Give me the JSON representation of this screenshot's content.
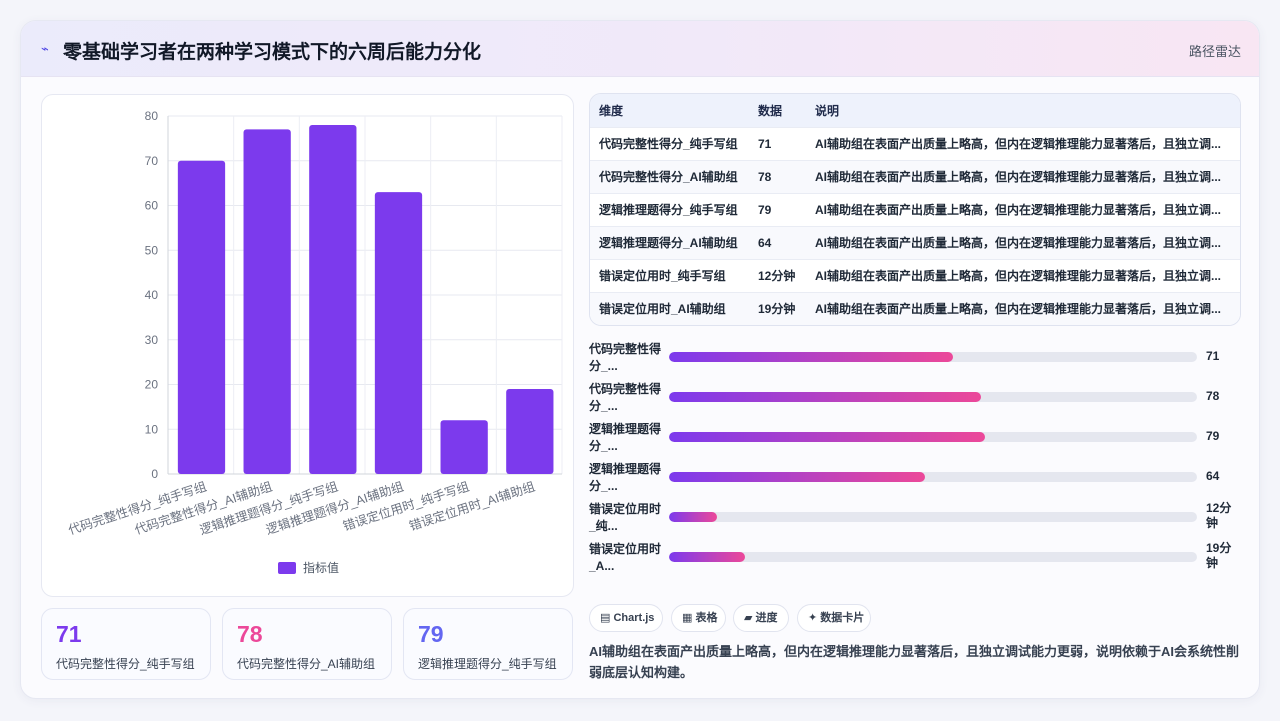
{
  "header": {
    "logo": "⌁",
    "title": "零基础学习者在两种学习模式下的六周后能力分化",
    "tag": "路径雷达"
  },
  "chart_data": {
    "type": "bar",
    "categories": [
      "代码完整性得分_纯手写组",
      "代码完整性得分_AI辅助组",
      "逻辑推理题得分_纯手写组",
      "逻辑推理题得分_AI辅助组",
      "错误定位用时_纯手写组",
      "错误定位用时_AI辅助组"
    ],
    "series": [
      {
        "name": "指标值",
        "values": [
          70,
          77,
          78,
          63,
          12,
          19
        ]
      }
    ],
    "ylim": [
      0,
      80
    ],
    "yticks": [
      0,
      10,
      20,
      30,
      40,
      50,
      60,
      70,
      80
    ],
    "grid": true,
    "legend": "bottom",
    "color": "#7c3aed"
  },
  "kpis": [
    {
      "value": "71",
      "label": "代码完整性得分_纯手写组",
      "color": "#7c3aed"
    },
    {
      "value": "78",
      "label": "代码完整性得分_AI辅助组",
      "color": "#ec4899"
    },
    {
      "value": "79",
      "label": "逻辑推理题得分_纯手写组",
      "color": "#6366f1"
    }
  ],
  "table": {
    "headers": [
      "维度",
      "数据",
      "说明"
    ],
    "rows": [
      [
        "代码完整性得分_纯手写组",
        "71",
        "AI辅助组在表面产出质量上略高，但内在逻辑推理能力显著落后，且独立调..."
      ],
      [
        "代码完整性得分_AI辅助组",
        "78",
        "AI辅助组在表面产出质量上略高，但内在逻辑推理能力显著落后，且独立调..."
      ],
      [
        "逻辑推理题得分_纯手写组",
        "79",
        "AI辅助组在表面产出质量上略高，但内在逻辑推理能力显著落后，且独立调..."
      ],
      [
        "逻辑推理题得分_AI辅助组",
        "64",
        "AI辅助组在表面产出质量上略高，但内在逻辑推理能力显著落后，且独立调..."
      ],
      [
        "错误定位用时_纯手写组",
        "12分钟",
        "AI辅助组在表面产出质量上略高，但内在逻辑推理能力显著落后，且独立调..."
      ],
      [
        "错误定位用时_AI辅助组",
        "19分钟",
        "AI辅助组在表面产出质量上略高，但内在逻辑推理能力显著落后，且独立调..."
      ]
    ]
  },
  "progress": [
    {
      "label": "代码完整性得分_...",
      "value": "71",
      "fraction": 0.537
    },
    {
      "label": "代码完整性得分_...",
      "value": "78",
      "fraction": 0.59
    },
    {
      "label": "逻辑推理题得分_...",
      "value": "79",
      "fraction": 0.598
    },
    {
      "label": "逻辑推理题得分_...",
      "value": "64",
      "fraction": 0.484
    },
    {
      "label": "错误定位用时_纯...",
      "value": "12分钟",
      "fraction": 0.091
    },
    {
      "label": "错误定位用时_A...",
      "value": "19分钟",
      "fraction": 0.144
    }
  ],
  "chips": [
    {
      "icon": "▤",
      "label": "Chart.js"
    },
    {
      "icon": "▦",
      "label": "表格"
    },
    {
      "icon": "▰",
      "label": "进度"
    },
    {
      "icon": "✦",
      "label": "数据卡片"
    }
  ],
  "summary": "AI辅助组在表面产出质量上略高，但内在逻辑推理能力显著落后，且独立调试能力更弱，说明依赖于AI会系统性削弱底层认知构建。"
}
